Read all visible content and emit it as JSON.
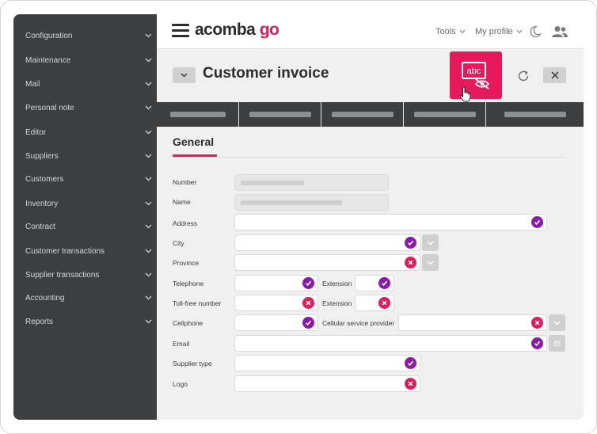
{
  "sidebar": {
    "items": [
      {
        "label": "Configuration"
      },
      {
        "label": "Maintenance"
      },
      {
        "label": "Mail"
      },
      {
        "label": "Personal note"
      },
      {
        "label": "Editor"
      },
      {
        "label": "Suppliers"
      },
      {
        "label": "Customers"
      },
      {
        "label": "Inventory"
      },
      {
        "label": "Contract"
      },
      {
        "label": "Customer transactions"
      },
      {
        "label": "Supplier transactions"
      },
      {
        "label": "Accounting"
      },
      {
        "label": "Reports"
      }
    ]
  },
  "topbar": {
    "logo_main": "acomba ",
    "logo_accent": "go",
    "tools_label": "Tools",
    "profile_label": "My profile"
  },
  "page": {
    "title": "Customer invoice",
    "spellcheck_button_text": "abc",
    "section_title": "General"
  },
  "form": {
    "number_label": "Number",
    "name_label": "Name",
    "address_label": "Address",
    "city_label": "City",
    "province_label": "Province",
    "telephone_label": "Telephone",
    "extension_label": "Extension",
    "tollfree_label": "Toll-free number",
    "extension2_label": "Extension",
    "cellphone_label": "Cellphone",
    "cellular_provider_label": "Cellular service provider",
    "email_label": "Email",
    "supplier_type_label": "Supplier type",
    "logo_label": "Logo",
    "statuses": {
      "address": "valid",
      "city": "valid",
      "province": "invalid",
      "telephone": "valid",
      "extension": "valid",
      "tollfree": "invalid",
      "extension2": "invalid",
      "cellphone": "valid",
      "cellular_provider": "invalid",
      "email": "valid",
      "supplier_type": "valid",
      "logo": "invalid"
    }
  },
  "colors": {
    "accent": "#e6195a",
    "valid": "#8b1aa9",
    "sidebar_bg": "#3d3e40"
  }
}
